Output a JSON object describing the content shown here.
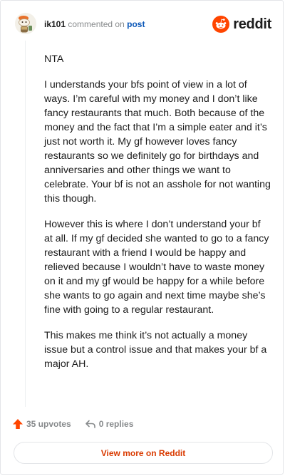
{
  "header": {
    "username": "ik101",
    "commented_text": "commented on",
    "post_link": "post",
    "logo_text": "reddit"
  },
  "comment": {
    "paragraphs": [
      "NTA",
      "I understands your bfs point of view in a lot of ways. I’m careful with my money and I don’t like fancy restaurants that much. Both because of the money and the fact that I’m a simple eater and it’s just not worth it. My gf however loves fancy restaurants so we definitely go for birthdays and anniversaries and other things we want to celebrate. Your bf is not an asshole for not wanting this though.",
      "However this is where I don’t understand your bf at all. If my gf decided she wanted to go to a fancy restaurant with a friend I would be happy and relieved because I wouldn’t have to waste money on it and my gf would be happy for a while before she wants to go again and next time maybe she’s fine with going to a regular restaurant.",
      "This makes me think it’s not actually a money issue but a control issue and that makes your bf a major AH."
    ]
  },
  "footer": {
    "upvotes": "35 upvotes",
    "replies": "0 replies",
    "view_more": "View more on Reddit"
  },
  "colors": {
    "brand": "#ff4500",
    "link": "#0a57b8",
    "view_more_text": "#d93a00",
    "muted": "#878a8c"
  },
  "icons": {
    "avatar": "snoo-avatar",
    "logo": "reddit-snoo-icon",
    "upvote": "upvote-arrow-icon",
    "reply": "reply-arrow-icon"
  }
}
